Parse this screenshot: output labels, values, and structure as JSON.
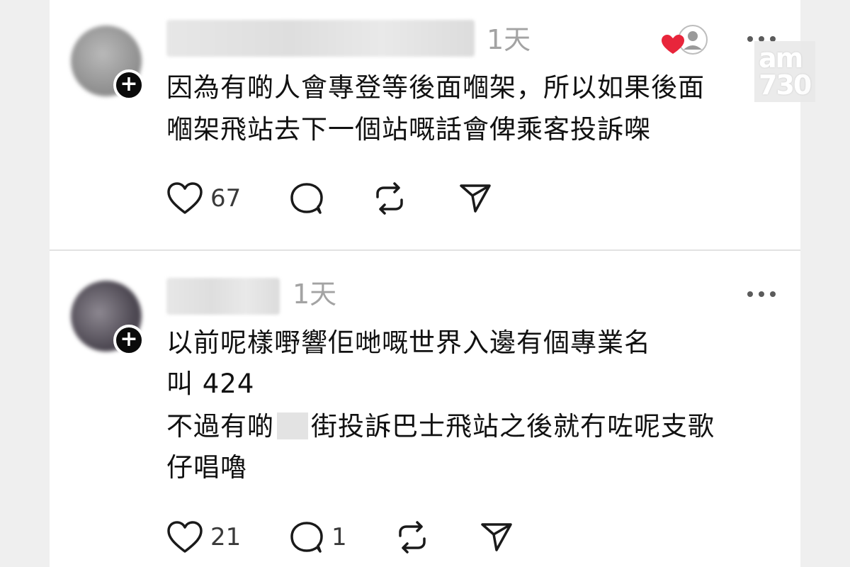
{
  "posts": [
    {
      "time": "1天",
      "lines": [
        "因為有啲人會專登等後面嗰架，所以如果後面",
        "嗰架飛站去下一個站嘅話會俾乘客投訴㗎"
      ],
      "likes": "67",
      "replies": "",
      "liked_by_icon": "liked-by-author-icon"
    },
    {
      "time": "1天",
      "lines": [
        "以前呢樣嘢響佢哋嘅世界入邊有個專業名",
        "叫 424"
      ],
      "line3_before": "不過有啲",
      "line3_after": "街投訴巴士飛站之後就冇咗呢支歌",
      "line4": "仔唱嚕",
      "likes": "21",
      "replies": "1"
    }
  ],
  "watermark": {
    "line1": "am",
    "line2": "730"
  },
  "colors": {
    "heart_red": "#e8253b",
    "text": "#111111",
    "muted": "#a3a3a3"
  }
}
